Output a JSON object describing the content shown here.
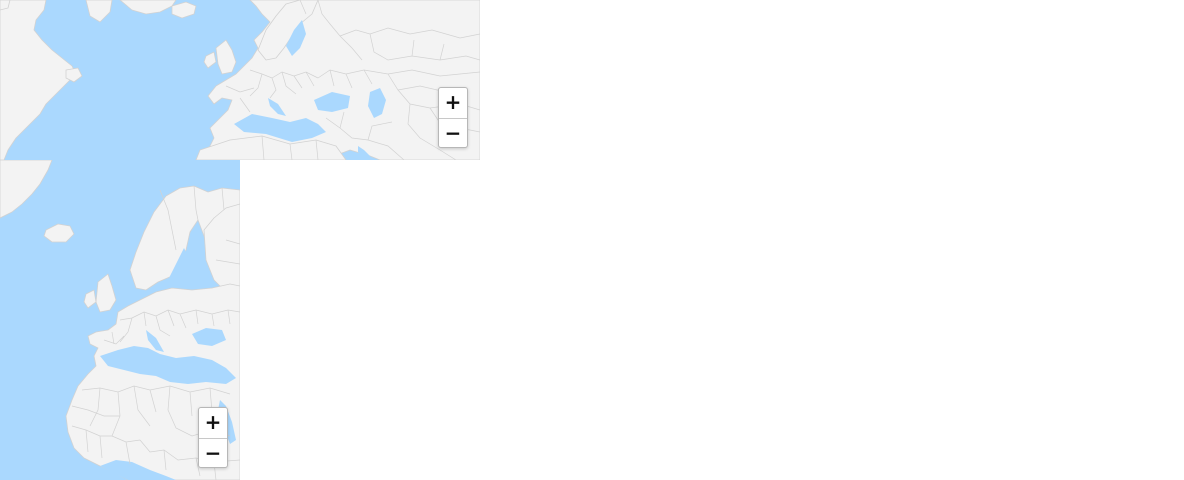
{
  "colors": {
    "water": "#aad8fe",
    "land": "#f3f3f3",
    "border": "#d2d2d2"
  },
  "maps": [
    {
      "view": "north-atlantic-europe",
      "zoom_in_label": "+",
      "zoom_out_label": "−",
      "zoom_in_icon": "plus-icon",
      "zoom_out_icon": "minus-icon"
    },
    {
      "view": "europe-africa",
      "zoom_in_label": "+",
      "zoom_out_label": "−",
      "zoom_in_icon": "plus-icon",
      "zoom_out_icon": "minus-icon"
    }
  ]
}
